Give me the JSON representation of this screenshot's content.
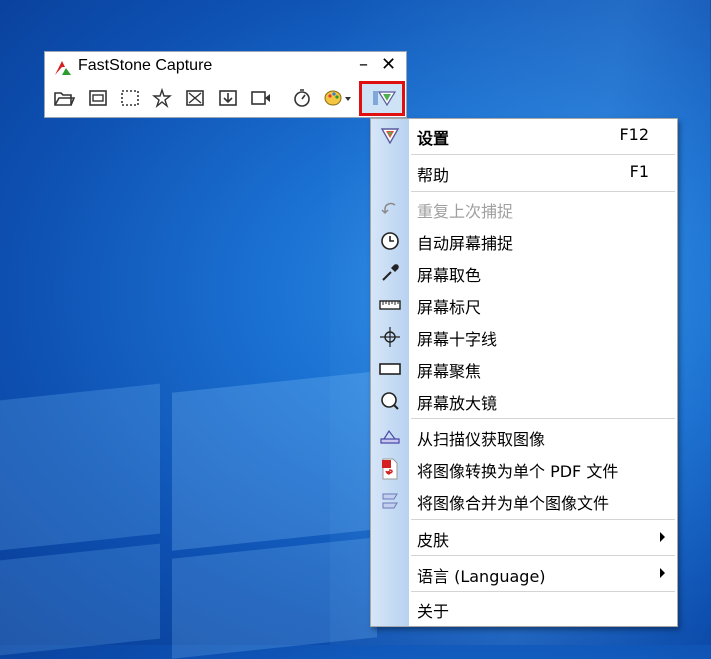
{
  "desktop": {
    "accent": "#1a6fd0"
  },
  "toolbar": {
    "title": "FastStone Capture",
    "minimize_label": "–",
    "close_label": "✕",
    "buttons": [
      {
        "name": "open-icon"
      },
      {
        "name": "capture-window-icon"
      },
      {
        "name": "capture-rect-icon"
      },
      {
        "name": "capture-freehand-icon"
      },
      {
        "name": "capture-fullscreen-icon"
      },
      {
        "name": "capture-scroll-icon"
      },
      {
        "name": "screen-record-icon"
      },
      {
        "name": "timer-icon"
      },
      {
        "name": "output-palette-icon"
      },
      {
        "name": "settings-icon"
      }
    ],
    "highlight_color": "#e01010"
  },
  "menu": {
    "items": [
      {
        "label": "设置",
        "shortcut": "F12",
        "icon": "settings-icon",
        "bold": true
      },
      {
        "label": "帮助",
        "shortcut": "F1"
      },
      {
        "label": "重复上次捕捉",
        "icon": "repeat-icon",
        "disabled": true
      },
      {
        "label": "自动屏幕捕捉",
        "icon": "clock-icon"
      },
      {
        "label": "屏幕取色",
        "icon": "eyedropper-icon"
      },
      {
        "label": "屏幕标尺",
        "icon": "ruler-icon"
      },
      {
        "label": "屏幕十字线",
        "icon": "crosshair-icon"
      },
      {
        "label": "屏幕聚焦",
        "icon": "focus-rect-icon"
      },
      {
        "label": "屏幕放大镜",
        "icon": "magnifier-icon"
      },
      {
        "label": "从扫描仪获取图像",
        "icon": "scanner-icon"
      },
      {
        "label": "将图像转换为单个 PDF 文件",
        "icon": "pdf-icon"
      },
      {
        "label": "将图像合并为单个图像文件",
        "icon": "merge-icon"
      },
      {
        "label": "皮肤",
        "submenu": true
      },
      {
        "label": "语言 (Language)",
        "submenu": true
      },
      {
        "label": "关于"
      }
    ]
  }
}
